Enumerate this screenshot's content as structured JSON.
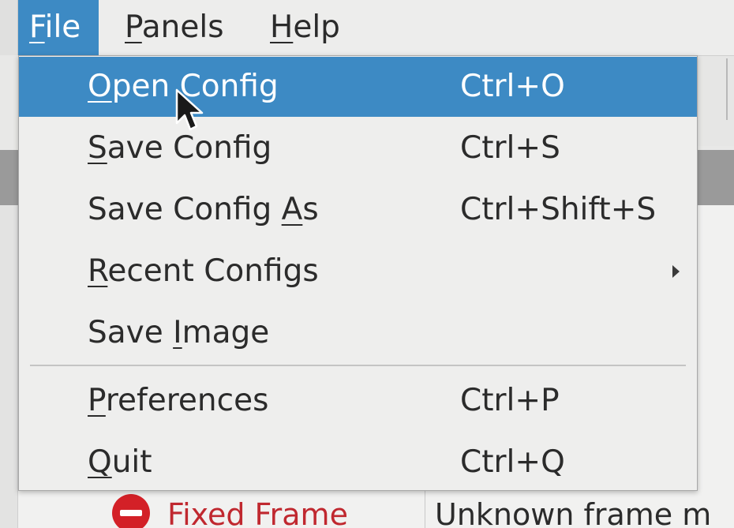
{
  "menubar": {
    "items": [
      {
        "label": "File",
        "mnemonic": "F",
        "rest": "ile"
      },
      {
        "label": "Panels",
        "mnemonic": "P",
        "rest": "anels"
      },
      {
        "label": "Help",
        "mnemonic": "H",
        "rest": "elp"
      }
    ]
  },
  "file_menu": {
    "items": [
      {
        "pre": "",
        "mn": "O",
        "post": "pen Config",
        "shortcut": "Ctrl+O"
      },
      {
        "pre": "",
        "mn": "S",
        "post": "ave Config",
        "shortcut": "Ctrl+S"
      },
      {
        "pre": "Save Config ",
        "mn": "A",
        "post": "s",
        "shortcut": "Ctrl+Shift+S"
      },
      {
        "pre": "",
        "mn": "R",
        "post": "ecent Configs",
        "shortcut": ""
      },
      {
        "pre": "Save ",
        "mn": "I",
        "post": "mage",
        "shortcut": ""
      },
      {
        "pre": "",
        "mn": "P",
        "post": "references",
        "shortcut": "Ctrl+P"
      },
      {
        "pre": "",
        "mn": "Q",
        "post": "uit",
        "shortcut": "Ctrl+Q"
      }
    ]
  },
  "background": {
    "row_label": "Fixed Frame",
    "row_value": "Unknown frame m",
    "row_label_color": "#c0282f",
    "status_icon": "error-icon"
  },
  "colors": {
    "accent": "#3d8ac4",
    "menu_bg": "#eeeeed",
    "text": "#2b2b2b"
  }
}
